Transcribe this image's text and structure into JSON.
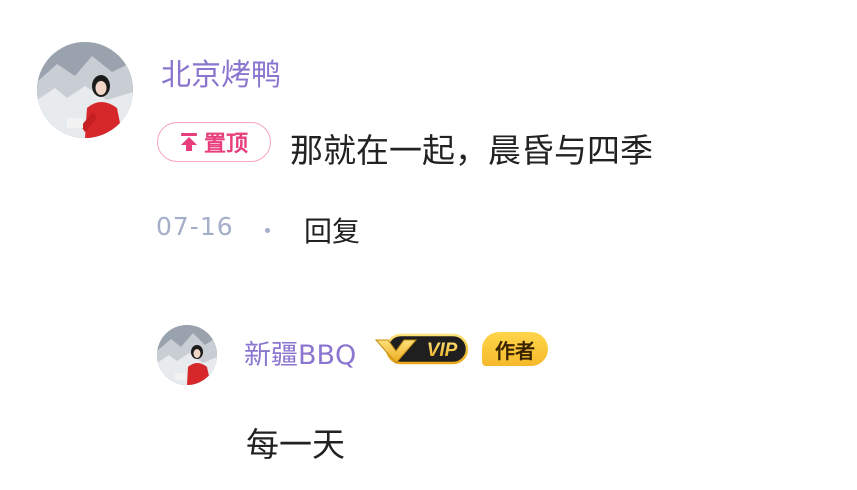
{
  "comment": {
    "username": "北京烤鸭",
    "pin_label": "置顶",
    "text": "那就在一起，晨昏与四季",
    "date": "07-16",
    "reply_label": "回复"
  },
  "reply": {
    "username": "新疆BBQ",
    "vip_label": "VIP",
    "author_label": "作者",
    "text": "每一天"
  },
  "colors": {
    "username": "#8a76cf",
    "pin": "#e83f7c",
    "meta": "#a5aec8",
    "author_badge": "#f6b92b"
  }
}
